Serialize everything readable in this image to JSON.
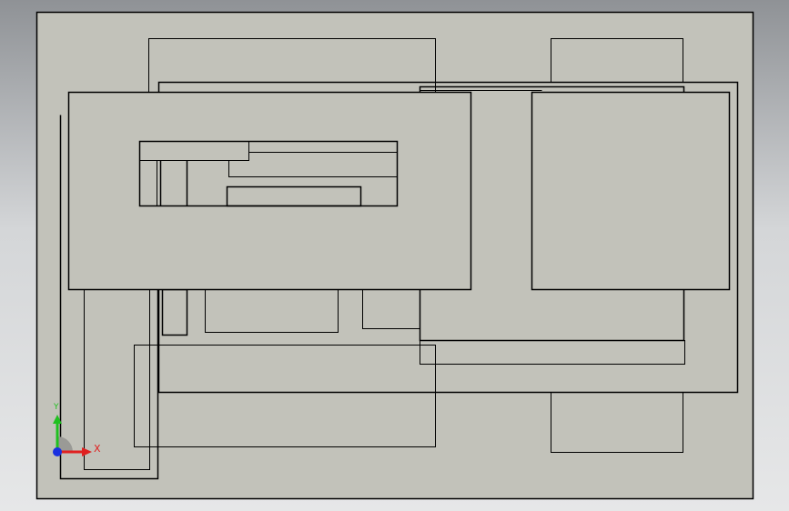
{
  "viewport": {
    "background_top": "#8f9296",
    "background_bottom": "#e6e7e8"
  },
  "drawing": {
    "sheet_color": "#c2c2ba",
    "line_color": "#000000"
  },
  "triad": {
    "x_label": "X",
    "y_label": "Y",
    "x_color": "#e02020",
    "y_color": "#20c020",
    "z_color": "#1a30e0"
  }
}
